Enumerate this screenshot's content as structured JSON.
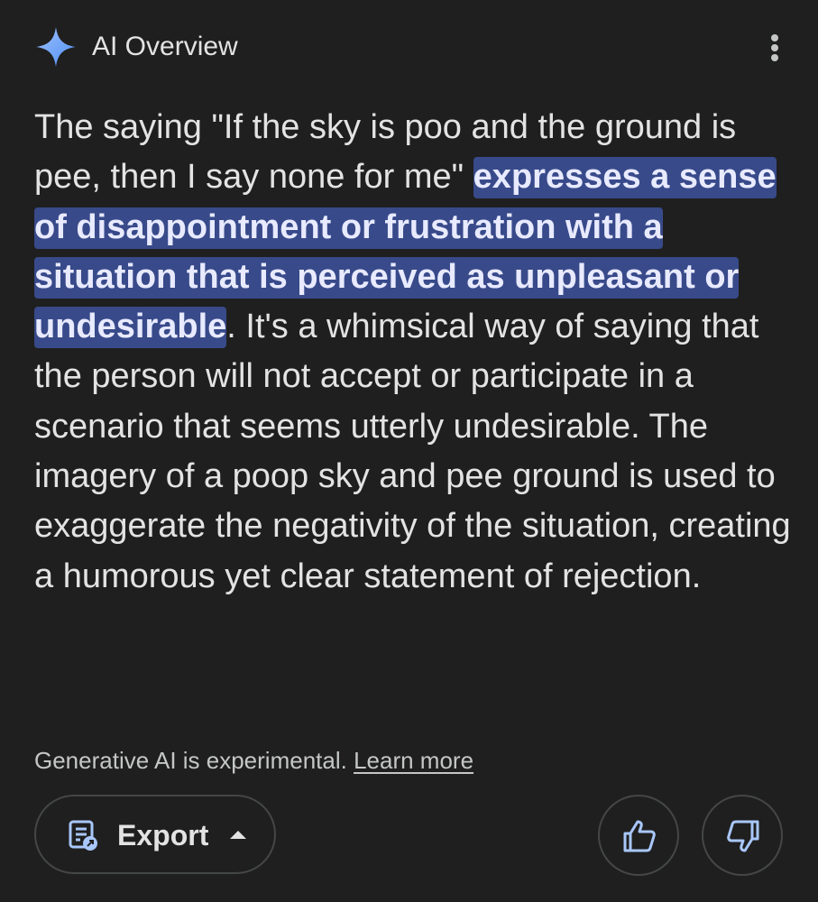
{
  "header": {
    "title": "AI Overview",
    "icon": "gemini-sparkle-icon",
    "more_icon": "more-vertical-icon"
  },
  "overview": {
    "text_before": "The saying \"If the sky is poo and the ground is pee, then I say none for me\" ",
    "highlight": "expresses a sense of disappointment or frustration with a situation that is perceived as unpleasant or undesirable",
    "text_after": ". It's a whimsical way of saying that the person will not accept or participate in a scenario that seems utterly undesirable. The imagery of a poop sky and pee ground is used to exaggerate the negativity of the situation, creating a humorous yet clear statement of rejection."
  },
  "footer": {
    "disclaimer": "Generative AI is experimental.",
    "learn_more": "Learn more",
    "export_label": "Export",
    "export_icon": "export-document-icon",
    "caret_icon": "caret-up-icon",
    "thumbs_up_icon": "thumbs-up-icon",
    "thumbs_down_icon": "thumbs-down-icon"
  },
  "colors": {
    "background": "#1f1f1f",
    "text": "#e3e3e3",
    "highlight_bg": "#384a8a",
    "accent_blue": "#a8c7fa",
    "border": "#444746"
  }
}
